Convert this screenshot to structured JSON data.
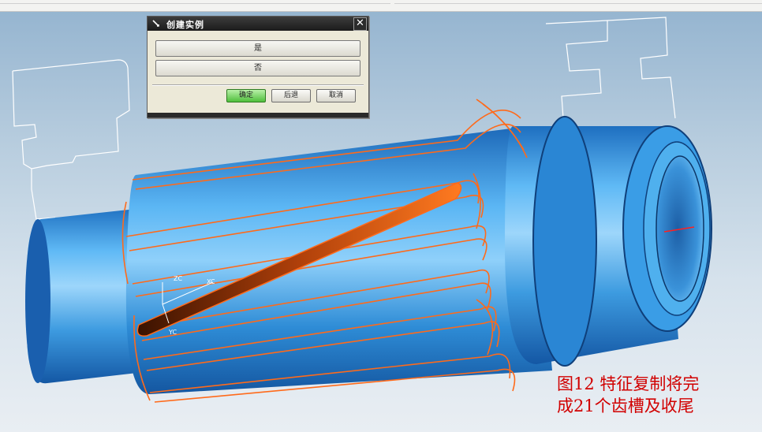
{
  "dialog": {
    "title": "创建实例",
    "yes_label": "是",
    "no_label": "否",
    "ok_label": "确定",
    "back_label": "后退",
    "cancel_label": "取消"
  },
  "axes": {
    "zc": "ZC",
    "yc": "YC",
    "xc": "XC"
  },
  "caption": {
    "line1": "图12  特征复制将完",
    "line2": "成21个齿槽及收尾"
  },
  "colors": {
    "shaft_blue": "#2f8fd9",
    "tooth_orange": "#ff6a1a",
    "caption_red": "#d10000"
  }
}
